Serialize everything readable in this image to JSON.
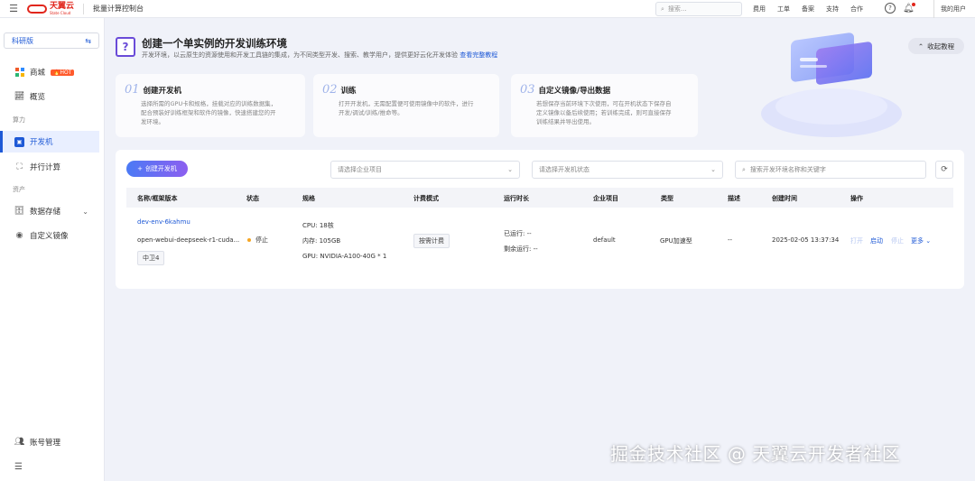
{
  "topbar": {
    "logo_text": "天翼云",
    "logo_sub": "State Cloud",
    "console_title": "批量计算控制台",
    "search_placeholder": "搜索...",
    "links": [
      "费用",
      "工单",
      "备案",
      "支持",
      "合作"
    ],
    "user": "我的用户"
  },
  "sidebar": {
    "edition": "科研版",
    "items": [
      {
        "label": "商城",
        "badge": "HOT"
      },
      {
        "label": "概览"
      },
      {
        "group": "算力"
      },
      {
        "label": "开发机"
      },
      {
        "label": "并行计算"
      },
      {
        "group": "资产"
      },
      {
        "label": "数据存储"
      },
      {
        "label": "自定义镜像"
      },
      {
        "label": "账号管理"
      }
    ]
  },
  "banner": {
    "title": "创建一个单实例的开发训练环境",
    "desc": "开发环境，以云原生的资源使用和开发工具链的集成，为不同类型开发、搜索、教学用户，提供更好云化开发体验",
    "link": "查看完整教程",
    "collapse": "收起教程",
    "steps": [
      {
        "num": "01",
        "title": "创建开发机",
        "desc": [
          "选择所需的GPU卡和规格，挂载对应的训练数据集，",
          "配合预装好训练框架和软件的镜像，快速搭建您的开",
          "发环境。"
        ]
      },
      {
        "num": "02",
        "title": "训练",
        "desc": [
          "打开开发机，无需配置便可使用镜像中的软件，进行",
          "开发/调试/训练/推命等。"
        ]
      },
      {
        "num": "03",
        "title": "自定义镜像/导出数据",
        "desc": [
          "若想保存当前环境下次使用，可在开机状态下保存自",
          "定义镜像以备后续使用；若训练完成，则可直接保存",
          "训练结果并导出使用。"
        ]
      }
    ]
  },
  "toolbar": {
    "create": "创建开发机",
    "project_placeholder": "请选择企业项目",
    "status_placeholder": "请选择开发机状态",
    "search_placeholder": "搜索开发环境名称和关键字"
  },
  "table": {
    "headers": [
      "名称/框架版本",
      "状态",
      "规格",
      "计费模式",
      "运行时长",
      "企业项目",
      "类型",
      "描述",
      "创建时间",
      "操作"
    ],
    "row": {
      "name": "dev-env-6kahmu",
      "image": "open-webui-deepseek-r1-cuda...",
      "region": "中卫4",
      "status": "停止",
      "cpu": "CPU: 18核",
      "mem": "内存: 105GB",
      "gpu": "GPU: NVIDIA-A100-40G * 1",
      "billing": "按需计费",
      "run_time": "已运行: --",
      "remain_time": "剩余运行: --",
      "project": "default",
      "type": "GPU加速型",
      "desc": "--",
      "created": "2025-02-05 13:37:34",
      "ops": [
        "打开",
        "启动",
        "停止",
        "更多"
      ]
    }
  },
  "watermark": "掘金技术社区 @ 天翼云开发者社区",
  "colors": {
    "primary": "#1e59d6",
    "brand": "#e1261c",
    "hot": "#ff5a2c",
    "status_stopped": "#f5a623"
  }
}
